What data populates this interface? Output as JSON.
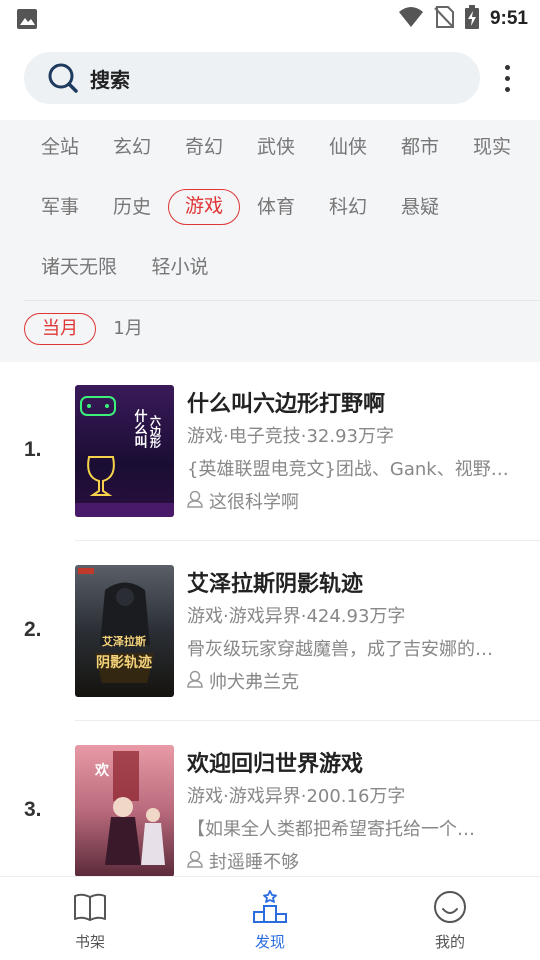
{
  "status_bar": {
    "time": "9:51"
  },
  "search": {
    "label": "搜索"
  },
  "categories": {
    "row1": [
      "全站",
      "玄幻",
      "奇幻",
      "武侠",
      "仙侠",
      "都市",
      "现实"
    ],
    "row2": [
      "军事",
      "历史",
      "游戏",
      "体育",
      "科幻",
      "悬疑"
    ],
    "row3": [
      "诸天无限",
      "轻小说"
    ],
    "selected": "游戏"
  },
  "months": {
    "items": [
      "当月",
      "1月"
    ],
    "selected": "当月"
  },
  "books": [
    {
      "rank": "1.",
      "title": "什么叫六边形打野啊",
      "meta": "游戏·电子竞技·32.93万字",
      "desc": "{英雄联盟电竞文}团战、Gank、视野…",
      "author": "这很科学啊",
      "cover_text": "什么叫六边形打野啊"
    },
    {
      "rank": "2.",
      "title": "艾泽拉斯阴影轨迹",
      "meta": "游戏·游戏异界·424.93万字",
      "desc": "骨灰级玩家穿越魔兽，成了吉安娜的…",
      "author": "帅犬弗兰克",
      "cover_text": "艾泽拉斯 阴影轨迹"
    },
    {
      "rank": "3.",
      "title": "欢迎回归世界游戏",
      "meta": "游戏·游戏异界·200.16万字",
      "desc": "【如果全人类都把希望寄托给一个…",
      "author": "封遥睡不够",
      "cover_text": "欢"
    }
  ],
  "nav": {
    "items": [
      {
        "label": "书架",
        "icon": "book-icon"
      },
      {
        "label": "发现",
        "icon": "discover-podium-icon"
      },
      {
        "label": "我的",
        "icon": "smile-face-icon"
      }
    ],
    "active": "发现"
  },
  "colors": {
    "accent_red": "#e03535",
    "accent_blue": "#2b6de0"
  }
}
